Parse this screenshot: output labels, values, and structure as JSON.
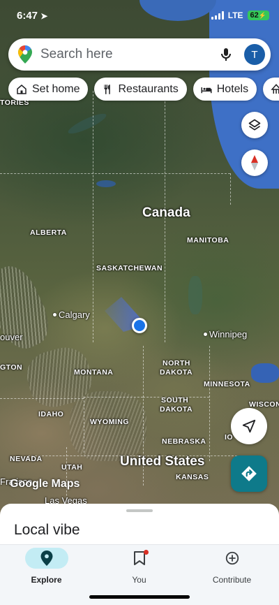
{
  "status_bar": {
    "time": "6:47",
    "network": "LTE",
    "battery": "62"
  },
  "search": {
    "placeholder": "Search here",
    "avatar_initial": "T"
  },
  "chips": [
    {
      "label": "Set home",
      "icon": "home-icon"
    },
    {
      "label": "Restaurants",
      "icon": "fork-knife-icon"
    },
    {
      "label": "Hotels",
      "icon": "bed-icon"
    },
    {
      "label": "",
      "icon": "attraction-icon"
    }
  ],
  "map": {
    "labels": {
      "canada": "Canada",
      "united_states": "United States",
      "alberta": "ALBERTA",
      "saskatchewan": "SASKATCHEWAN",
      "manitoba": "MANITOBA",
      "territories": "TORIES",
      "montana": "MONTANA",
      "north_dakota_1": "NORTH",
      "north_dakota_2": "DAKOTA",
      "south_dakota_1": "SOUTH",
      "south_dakota_2": "DAKOTA",
      "minnesota": "MINNESOTA",
      "wisconsin": "WISCON",
      "idaho": "IDAHO",
      "wyoming": "WYOMING",
      "nebraska": "NEBRASKA",
      "iowa": "IO",
      "nevada": "NEVADA",
      "utah": "UTAH",
      "kansas": "KANSAS",
      "washington_partial": "GTON",
      "calgary": "Calgary",
      "winnipeg": "Winnipeg",
      "vancouver_partial": "ouver",
      "san_francisco_partial": "Fra  isco",
      "las_vegas": "Las Vegas"
    },
    "watermark": "Google Maps"
  },
  "sheet": {
    "title": "Local vibe"
  },
  "bottom_nav": [
    {
      "label": "Explore",
      "icon": "explore-pin-icon",
      "active": true
    },
    {
      "label": "You",
      "icon": "bookmark-icon",
      "active": false
    },
    {
      "label": "Contribute",
      "icon": "add-circle-icon",
      "active": false
    }
  ],
  "colors": {
    "accent": "#0e7a8a",
    "location_blue": "#1a73e8",
    "active_tab_bg": "#c3ecf4"
  }
}
